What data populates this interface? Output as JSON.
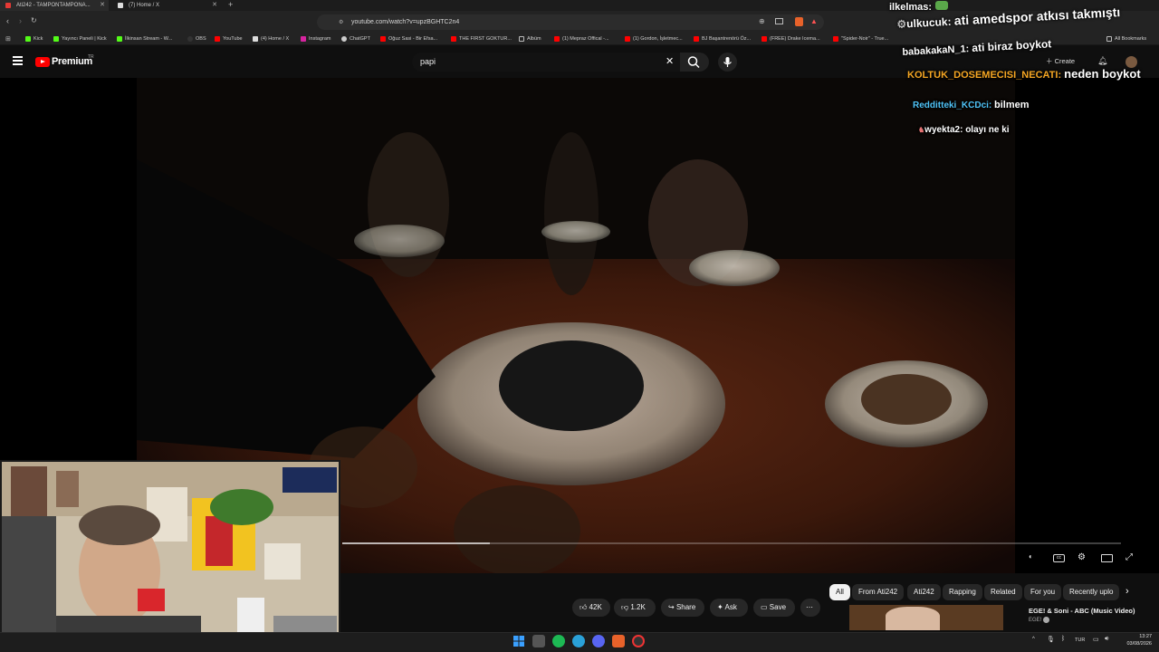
{
  "browser": {
    "tabs": [
      {
        "label": "Ati242 - TAMPONTAMPONA...",
        "active": true
      },
      {
        "label": "(7) Home / X",
        "active": false
      }
    ],
    "url": "youtube.com/watch?v=upzBGHTC2n4",
    "bookmarks": [
      "Kick",
      "Yayıncı Paneli | Kick",
      "İlkinsan Stream - W...",
      "OBS",
      "YouTube",
      "(4) Home / X",
      "Instagram",
      "ChatGPT",
      "Oğuz Sasi - Bir Efsa...",
      "THE FIRST GOKTUR...",
      "Albüm",
      "(1) Mepraz Offical -...",
      "(1) Gordon, İşletmec...",
      "BJ Başantrenörü Öz...",
      "(FREE) Drake Icema...",
      "\"Spider-Noir\" - True..."
    ],
    "all_bookmarks": "All Bookmarks"
  },
  "youtube": {
    "logo_text": "Premium",
    "region": "TR",
    "search_query": "papi",
    "create_label": "Create"
  },
  "player": {
    "progress_fraction": 0.19
  },
  "chat": [
    {
      "user": "ilkelmas:",
      "message": "",
      "user_color": "#ffffff"
    },
    {
      "user": "ulkucuk:",
      "message": "ati amedspor atkısı takmıştı",
      "user_color": "#ffffff"
    },
    {
      "user": "babakakaN_1:",
      "message": "ati biraz boykot",
      "user_color": "#ffffff"
    },
    {
      "user": "KOLTUK_DOSEMECISI_NECATI:",
      "message": "neden boykot",
      "user_color": "#f5a623"
    },
    {
      "user": "Redditteki_KCDci:",
      "message": "bilmem",
      "user_color": "#4fc3f7"
    },
    {
      "user": "wyekta2:",
      "message": "olayı ne ki",
      "user_color": "#ffffff"
    }
  ],
  "actions": {
    "likes": "42K",
    "dislikes": "1.2K",
    "share": "Share",
    "ask": "Ask",
    "save": "Save",
    "more": "⋯"
  },
  "chips": [
    "All",
    "From Ati242",
    "Ati242",
    "Rapping",
    "Related",
    "For you",
    "Recently uplo"
  ],
  "up_next": {
    "title": "EGE! & Soni - ABC (Music Video)",
    "channel": "EGE!"
  },
  "taskbar": {
    "lang": "TUR",
    "time": "13:27",
    "date": "03/08/2026"
  },
  "colors": {
    "yt_red": "#ff0000",
    "background": "#0f0f0f"
  }
}
